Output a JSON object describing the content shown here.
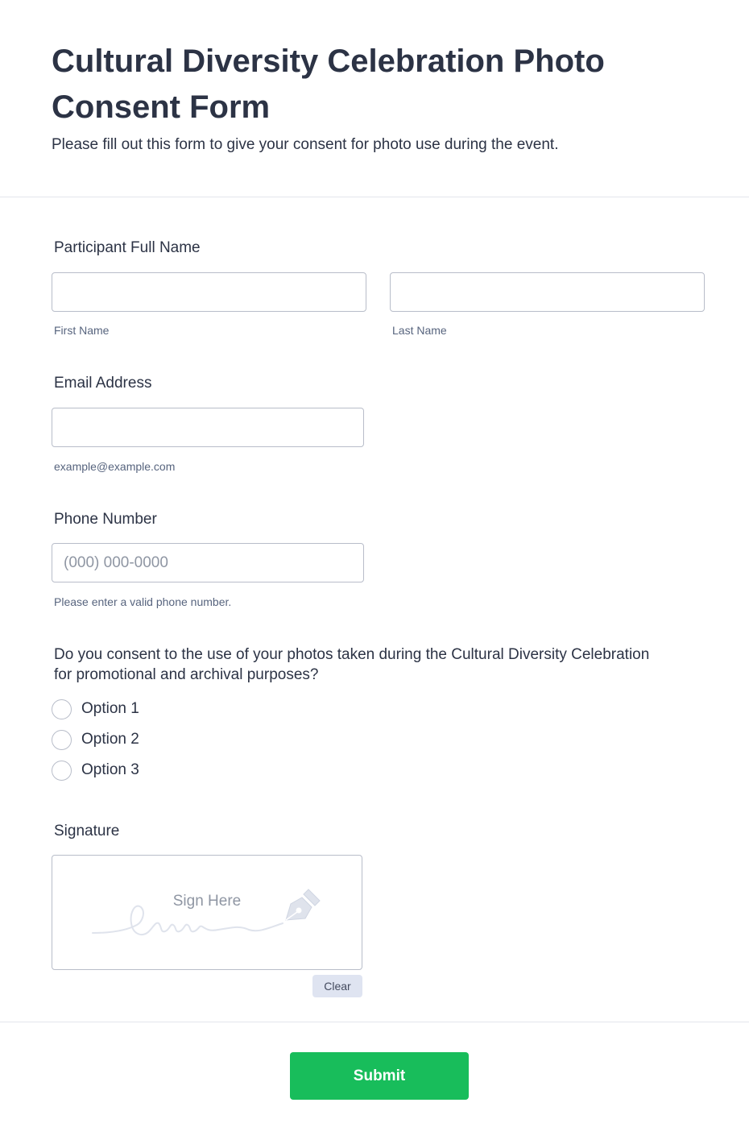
{
  "header": {
    "title": "Cultural Diversity Celebration Photo Consent Form",
    "subtitle": "Please fill out this form to give your consent for photo use during the event."
  },
  "name_field": {
    "label": "Participant Full Name",
    "first_value": "",
    "last_value": "",
    "first_sublabel": "First Name",
    "last_sublabel": "Last Name"
  },
  "email_field": {
    "label": "Email Address",
    "value": "",
    "sublabel": "example@example.com"
  },
  "phone_field": {
    "label": "Phone Number",
    "value": "",
    "placeholder": "(000) 000-0000",
    "sublabel": "Please enter a valid phone number."
  },
  "consent_question": {
    "label": "Do you consent to the use of your photos taken during the Cultural Diversity Celebration for promotional and archival purposes?",
    "options": [
      "Option 1",
      "Option 2",
      "Option 3"
    ],
    "selected": null
  },
  "signature": {
    "label": "Signature",
    "placeholder": "Sign Here",
    "clear_label": "Clear",
    "icon": "pen-nib-icon"
  },
  "submit": {
    "label": "Submit"
  },
  "colors": {
    "text": "#2c3345",
    "sublabel": "#57647e",
    "border": "#b8bdc9",
    "submit_bg": "#18bd5b",
    "clear_bg": "#dfe4f1"
  }
}
